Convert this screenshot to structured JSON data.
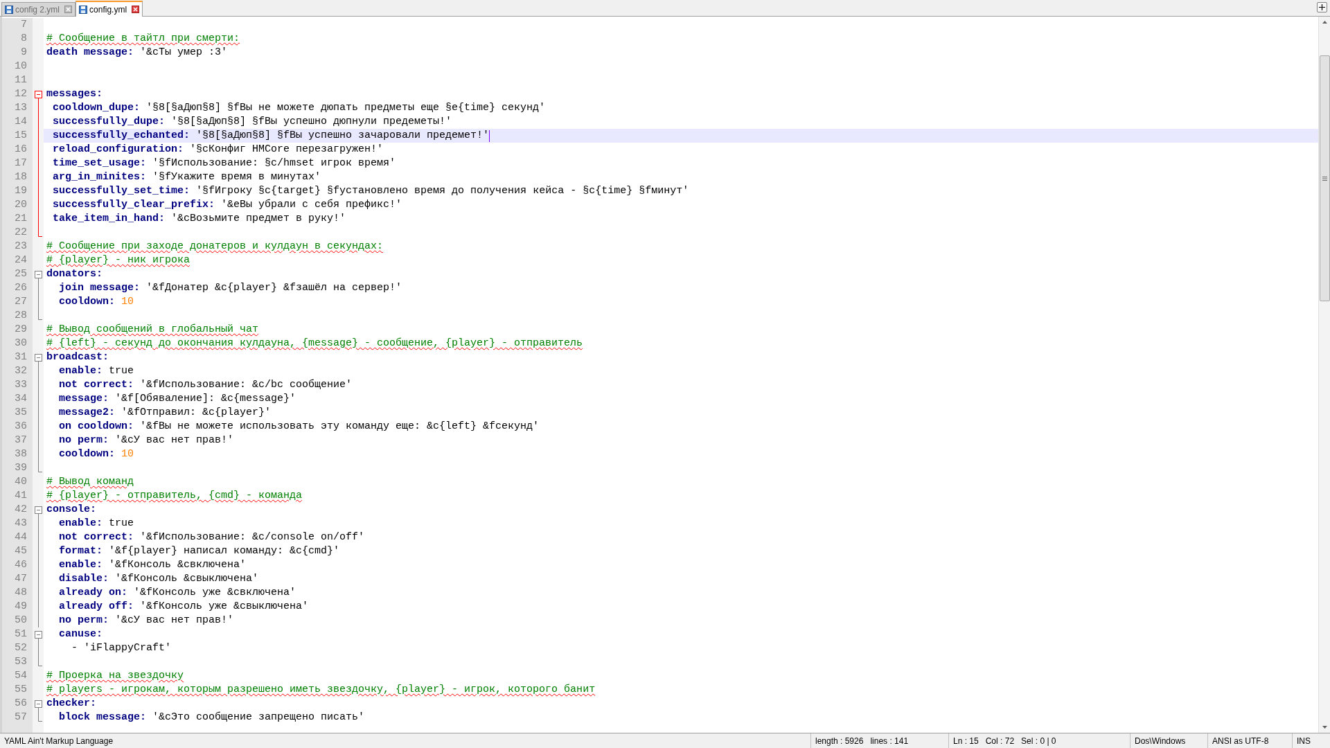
{
  "tabs": [
    {
      "label": "config 2.yml",
      "selected": false
    },
    {
      "label": "config.yml",
      "selected": true
    }
  ],
  "lines": [
    {
      "number": "7",
      "kind": "blank"
    },
    {
      "number": "8",
      "kind": "comment",
      "text": "# Сообщение в тайтл при смерти:"
    },
    {
      "number": "9",
      "kind": "pair",
      "key": "death message:",
      "value": "'&cТы умер :3'"
    },
    {
      "number": "10",
      "kind": "blank"
    },
    {
      "number": "11",
      "kind": "blank"
    },
    {
      "number": "12",
      "kind": "section",
      "key": "messages:",
      "expanded": true,
      "children": [
        {
          "number": "13",
          "kind": "pair",
          "key": " cooldown_dupe:",
          "value": "'§8[§aДюп§8] §fВы не можете дюпать предметы еще §e{time} секунд'"
        },
        {
          "number": "14",
          "kind": "pair",
          "key": " successfully_dupe:",
          "value": "'§8[§aДюп§8] §fВы успешно дюпнули предеметы!'"
        },
        {
          "number": "15",
          "kind": "pair",
          "key": " successfully_echanted:",
          "value": "'§8[§aДюп§8] §fВы успешно зачаровали предемет!'",
          "selected": true
        },
        {
          "number": "16",
          "kind": "pair",
          "key": " reload_configuration:",
          "value": "'§cКонфиг HMCore перезагружен!'"
        },
        {
          "number": "17",
          "kind": "pair",
          "key": " time_set_usage:",
          "value": "'§fИспользование: §c/hmset игрок время'"
        },
        {
          "number": "18",
          "kind": "pair",
          "key": " arg_in_minites:",
          "value": "'§fУкажите время в минутах'"
        },
        {
          "number": "19",
          "kind": "pair",
          "key": " successfully_set_time:",
          "value": "'§fИгроку §c{target} §fустановлено время до получения кейса - §c{time} §fминут'"
        },
        {
          "number": "20",
          "kind": "pair",
          "key": " successfully_clear_prefix:",
          "value": "'&eВы убрали с себя префикс!'"
        },
        {
          "number": "21",
          "kind": "pair",
          "key": " take_item_in_hand:",
          "value": "'&cВозьмите предмет в руку!'"
        },
        {
          "number": "22",
          "kind": "blank"
        }
      ]
    },
    {
      "number": "23",
      "kind": "comment",
      "text": "# Сообщение при заходе донатеров и кулдаун в секундах:"
    },
    {
      "number": "24",
      "kind": "comment",
      "text": "# {player} - ник игрока"
    },
    {
      "number": "25",
      "kind": "section",
      "key": "donators:",
      "expanded": true,
      "children": [
        {
          "number": "26",
          "kind": "pair",
          "key": "  join message:",
          "value": "'&fДонатер &c{player} &fзашёл на сервер!'"
        },
        {
          "number": "27",
          "kind": "number",
          "key": "  cooldown:",
          "value": "10"
        },
        {
          "number": "28",
          "kind": "blank"
        }
      ]
    },
    {
      "number": "29",
      "kind": "comment",
      "text": "# Вывод сообщений в глобальный чат"
    },
    {
      "number": "30",
      "kind": "comment",
      "text": "# {left} - секунд до окончания кулдауна, {message} - сообщение, {player} - отправитель"
    },
    {
      "number": "31",
      "kind": "section",
      "key": "broadcast:",
      "expanded": true,
      "children": [
        {
          "number": "32",
          "kind": "pair",
          "key": "  enable:",
          "value": "true"
        },
        {
          "number": "33",
          "kind": "pair",
          "key": "  not correct:",
          "value": "'&fИспользование: &c/bc сообщение'"
        },
        {
          "number": "34",
          "kind": "pair",
          "key": "  message:",
          "value": "'&f[Обявaление]: &c{message}'"
        },
        {
          "number": "35",
          "kind": "pair",
          "key": "  message2:",
          "value": "'&fОтправил: &c{player}'"
        },
        {
          "number": "36",
          "kind": "pair",
          "key": "  on cooldown:",
          "value": "'&fВы не можете использовать эту команду еще: &c{left} &fсекунд'"
        },
        {
          "number": "37",
          "kind": "pair",
          "key": "  no perm:",
          "value": "'&cУ вас нет прав!'"
        },
        {
          "number": "38",
          "kind": "number",
          "key": "  cooldown:",
          "value": "10"
        },
        {
          "number": "39",
          "kind": "blank"
        }
      ]
    },
    {
      "number": "40",
      "kind": "comment",
      "text": "# Вывод команд"
    },
    {
      "number": "41",
      "kind": "comment",
      "text": "# {player} - отправитель, {cmd} - команда"
    },
    {
      "number": "42",
      "kind": "section",
      "key": "console:",
      "expanded": true,
      "children": [
        {
          "number": "43",
          "kind": "pair",
          "key": "  enable:",
          "value": "true"
        },
        {
          "number": "44",
          "kind": "pair",
          "key": "  not correct:",
          "value": "'&fИспользование: &c/console on/off'"
        },
        {
          "number": "45",
          "kind": "pair",
          "key": "  format:",
          "value": "'&f{player} написал команду: &c{cmd}'"
        },
        {
          "number": "46",
          "kind": "pair",
          "key": "  enable:",
          "value": "'&fКонсоль &cвключена'"
        },
        {
          "number": "47",
          "kind": "pair",
          "key": "  disable:",
          "value": "'&fКонсоль &cвыключена'"
        },
        {
          "number": "48",
          "kind": "pair",
          "key": "  already on:",
          "value": "'&fКонсоль уже &cвключена'"
        },
        {
          "number": "49",
          "kind": "pair",
          "key": "  already off:",
          "value": "'&fКонсоль уже &cвыключена'"
        },
        {
          "number": "50",
          "kind": "pair",
          "key": "  no perm:",
          "value": "'&cУ вас нет прав!'"
        },
        {
          "number": "51",
          "kind": "section",
          "key": "  canuse:",
          "expanded": true,
          "children": [
            {
              "number": "52",
              "kind": "item",
              "text": "    - 'iFlappyCraft'"
            }
          ]
        },
        {
          "number": "53",
          "kind": "blank"
        }
      ]
    },
    {
      "number": "54",
      "kind": "comment",
      "text": "# Проерка на звездочку"
    },
    {
      "number": "55",
      "kind": "comment",
      "text": "# players - игрокам, которым разрешено иметь звездочку, {player} - игрок, которого банит"
    },
    {
      "number": "56",
      "kind": "section",
      "key": "checker:",
      "expanded": true,
      "children": [
        {
          "number": "57",
          "kind": "pair",
          "key": "  block message:",
          "value": "'&cЭто сообщение запрещено писать'"
        }
      ]
    }
  ],
  "status_bar": {
    "language": "YAML Ain't Markup Language",
    "length": "length : 5926",
    "lines": "lines : 141",
    "ln": "Ln : 15",
    "col": "Col : 72",
    "sel": "Sel : 0 | 0",
    "eol": "Dos\\Windows",
    "encoding": "ANSI as UTF-8",
    "mode": "INS"
  }
}
